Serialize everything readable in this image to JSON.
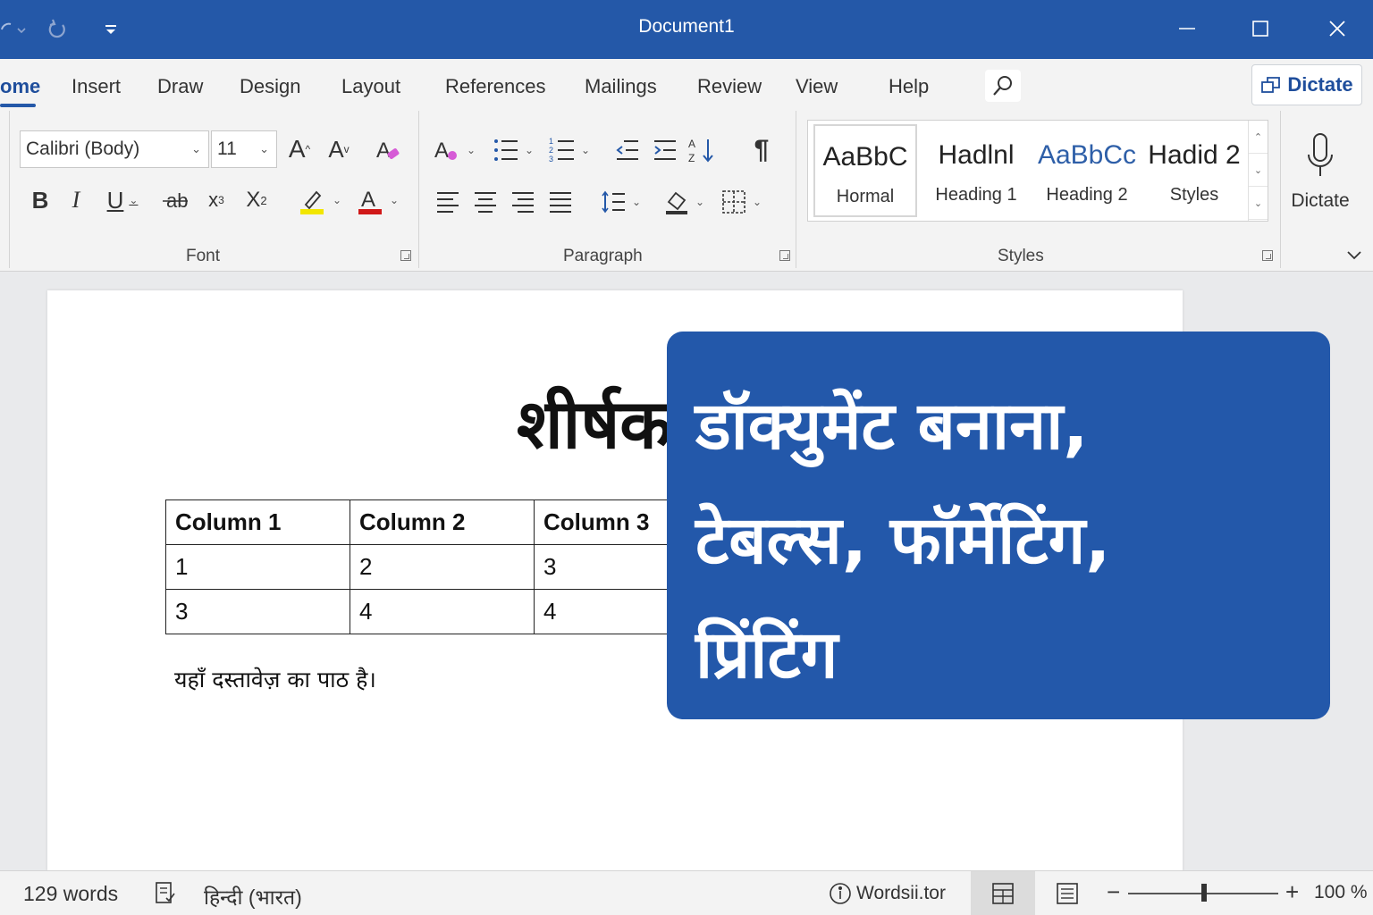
{
  "window": {
    "title": "Document1"
  },
  "tabs": [
    {
      "label": "ome"
    },
    {
      "label": "Insert"
    },
    {
      "label": "Draw"
    },
    {
      "label": "Design"
    },
    {
      "label": "Layout"
    },
    {
      "label": "References"
    },
    {
      "label": "Mailings"
    },
    {
      "label": "Review"
    },
    {
      "label": "View"
    },
    {
      "label": "Help"
    }
  ],
  "dictate_top": {
    "label": "Dictate"
  },
  "font": {
    "family": "Calibri (Body)",
    "size": "11",
    "group_label": "Font",
    "highlight_color": "#f2e600",
    "font_color": "#d01818"
  },
  "paragraph": {
    "group_label": "Paragraph",
    "pilcrow": "¶"
  },
  "styles": {
    "group_label": "Styles",
    "items": [
      {
        "preview": "AaBbC",
        "name": "Hormal",
        "color": "#222222"
      },
      {
        "preview": "Hadlnl",
        "name": "Heading 1",
        "color": "#222222"
      },
      {
        "preview": "AaBbCc",
        "name": "Heading 2",
        "color": "#2e5fa8"
      },
      {
        "preview": "Hadid 2",
        "name": "Styles",
        "color": "#222222"
      }
    ]
  },
  "dictate": {
    "label": "Dictate"
  },
  "document": {
    "title": "शीर्षक",
    "table": {
      "headers": [
        "Column 1",
        "Column 2",
        "Column 3"
      ],
      "rows": [
        [
          "1",
          "2",
          "3"
        ],
        [
          "3",
          "4",
          "4"
        ]
      ]
    },
    "paragraph": "यहाँ दस्तावेज़ का पाठ है।"
  },
  "banner": {
    "lines": [
      "डॉक्युमेंट बनाना,",
      "टेबल्स, फॉर्मेटिंग,",
      "प्रिंटिंग"
    ],
    "color": "#2358aa"
  },
  "status": {
    "words": "129 words",
    "language": "हिन्दी (भारत)",
    "website": "Wordsii.tor",
    "zoom": "100 %",
    "zoom_minus": "−",
    "zoom_plus": "+"
  }
}
